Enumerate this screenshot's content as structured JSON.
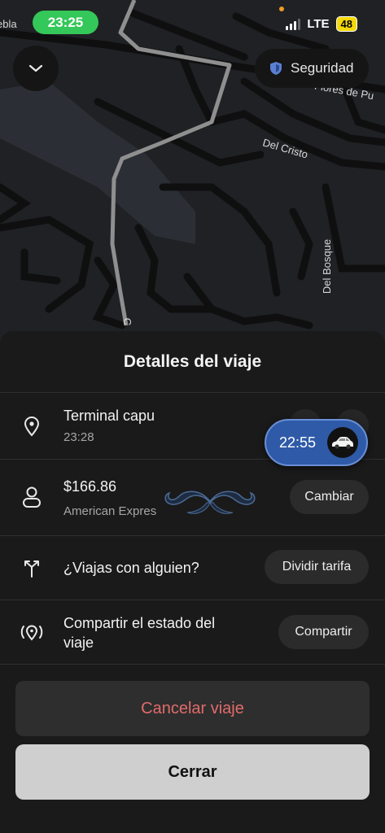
{
  "status_bar": {
    "time": "23:25",
    "network": "LTE",
    "battery": "48"
  },
  "map": {
    "streets": [
      "ebla",
      "Flores de Pu",
      "Del Cristo",
      "Del Bosque",
      "C"
    ]
  },
  "controls": {
    "security_label": "Seguridad"
  },
  "sheet": {
    "title": "Detalles del viaje",
    "destination": {
      "name": "Terminal capu",
      "time": "23:28"
    },
    "eta": {
      "time": "22:55"
    },
    "payment": {
      "amount": "$166.86",
      "method": "American Expres",
      "action": "Cambiar"
    },
    "split": {
      "label": "¿Viajas con alguien?",
      "action": "Dividir tarifa"
    },
    "share": {
      "label_line1": "Compartir el estado del",
      "label_line2": "viaje",
      "action": "Compartir"
    }
  },
  "buttons": {
    "cancel": "Cancelar viaje",
    "close": "Cerrar"
  },
  "colors": {
    "cancel_text": "#e26b6b",
    "eta_chip": "#2f5aa8",
    "status_time_bg": "#34c759",
    "battery": "#f5d90a"
  },
  "icons": [
    "chevron-down-icon",
    "shield-icon",
    "location-pin-icon",
    "car-icon",
    "person-icon",
    "split-arrows-icon",
    "broadcast-pin-icon"
  ]
}
